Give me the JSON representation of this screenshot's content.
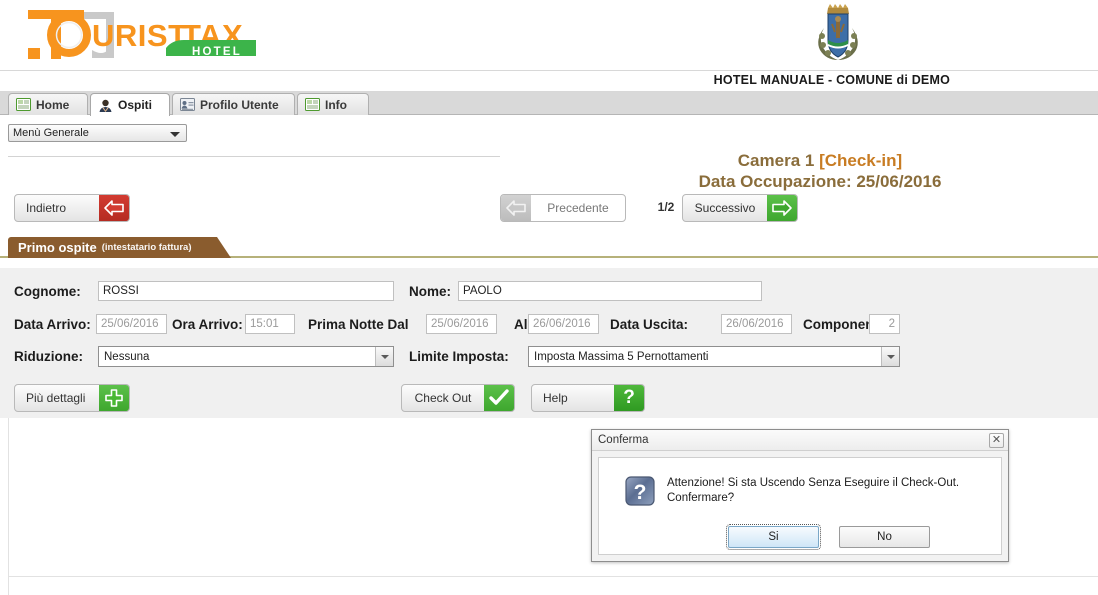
{
  "header": {
    "logo": {
      "word1": "T",
      "word2": "OURIST",
      "word3": "TAX",
      "badge": "HOTEL",
      "alt": "tourist-tax-hotel-logo"
    },
    "crest_alt": "comune-coat-of-arms",
    "org_title": "HOTEL MANUALE - COMUNE di DEMO"
  },
  "tabs": [
    {
      "label": "Home",
      "icon": "document-icon",
      "active": false
    },
    {
      "label": "Ospiti",
      "icon": "person-icon",
      "active": true
    },
    {
      "label": "Profilo Utente",
      "icon": "id-card-icon",
      "active": false
    },
    {
      "label": "Info",
      "icon": "document-icon",
      "active": false
    }
  ],
  "menu_select": {
    "value": "Menù Generale"
  },
  "room": {
    "line1_main": "Camera 1",
    "line1_state": "[Check-in]",
    "line2": "Data Occupazione: 25/06/2016"
  },
  "nav": {
    "back_label": "Indietro",
    "prev_label": "Precedente",
    "pager": "1/2",
    "next_label": "Successivo"
  },
  "section": {
    "title": "Primo ospite",
    "subtitle": "(intestatario fattura)"
  },
  "form": {
    "cognome_label": "Cognome:",
    "cognome_value": "ROSSI",
    "nome_label": "Nome:",
    "nome_value": "PAOLO",
    "data_arrivo_label": "Data Arrivo:",
    "data_arrivo_value": "25/06/2016",
    "ora_arrivo_label": "Ora Arrivo:",
    "ora_arrivo_value": "15:01",
    "prima_notte_label": "Prima Notte Dal",
    "prima_notte_value": "25/06/2016",
    "al_label": "Al",
    "al_value": "26/06/2016",
    "data_uscita_label": "Data Uscita:",
    "data_uscita_value": "26/06/2016",
    "componenti_label": "Componenti:",
    "componenti_value": "2",
    "riduzione_label": "Riduzione:",
    "riduzione_value": "Nessuna",
    "limite_label": "Limite Imposta:",
    "limite_value": "Imposta Massima 5 Pernottamenti"
  },
  "actions": {
    "details_label": "Più dettagli",
    "checkout_label": "Check Out",
    "help_label": "Help",
    "help_glyph": "?"
  },
  "dialog": {
    "title": "Conferma",
    "close_glyph": "✕",
    "icon": "question-icon",
    "message": "Attenzione! Si sta Uscendo Senza Eseguire il Check-Out. Confermare?",
    "yes_label": "Si",
    "no_label": "No"
  },
  "colors": {
    "brand_orange": "#F7941E",
    "brand_green": "#3CB44A",
    "section_brown": "#8a5c2e",
    "title_brown": "#8a6d3b",
    "accent_orange": "#c87c23",
    "danger_red": "#c0392b",
    "success_green": "#3ea72e"
  }
}
